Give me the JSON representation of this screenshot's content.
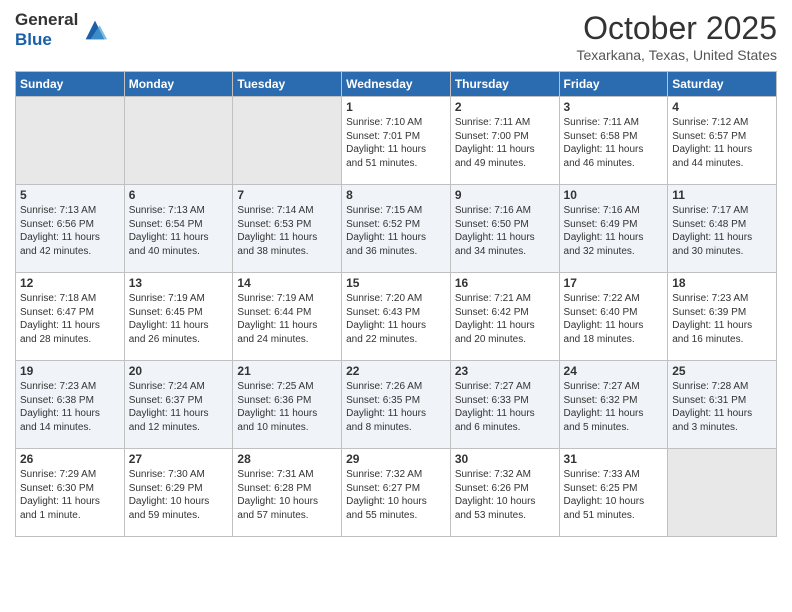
{
  "header": {
    "logo_line1": "General",
    "logo_line2": "Blue",
    "month": "October 2025",
    "location": "Texarkana, Texas, United States"
  },
  "days_of_week": [
    "Sunday",
    "Monday",
    "Tuesday",
    "Wednesday",
    "Thursday",
    "Friday",
    "Saturday"
  ],
  "weeks": [
    [
      {
        "day": "",
        "info": ""
      },
      {
        "day": "",
        "info": ""
      },
      {
        "day": "",
        "info": ""
      },
      {
        "day": "1",
        "info": "Sunrise: 7:10 AM\nSunset: 7:01 PM\nDaylight: 11 hours\nand 51 minutes."
      },
      {
        "day": "2",
        "info": "Sunrise: 7:11 AM\nSunset: 7:00 PM\nDaylight: 11 hours\nand 49 minutes."
      },
      {
        "day": "3",
        "info": "Sunrise: 7:11 AM\nSunset: 6:58 PM\nDaylight: 11 hours\nand 46 minutes."
      },
      {
        "day": "4",
        "info": "Sunrise: 7:12 AM\nSunset: 6:57 PM\nDaylight: 11 hours\nand 44 minutes."
      }
    ],
    [
      {
        "day": "5",
        "info": "Sunrise: 7:13 AM\nSunset: 6:56 PM\nDaylight: 11 hours\nand 42 minutes."
      },
      {
        "day": "6",
        "info": "Sunrise: 7:13 AM\nSunset: 6:54 PM\nDaylight: 11 hours\nand 40 minutes."
      },
      {
        "day": "7",
        "info": "Sunrise: 7:14 AM\nSunset: 6:53 PM\nDaylight: 11 hours\nand 38 minutes."
      },
      {
        "day": "8",
        "info": "Sunrise: 7:15 AM\nSunset: 6:52 PM\nDaylight: 11 hours\nand 36 minutes."
      },
      {
        "day": "9",
        "info": "Sunrise: 7:16 AM\nSunset: 6:50 PM\nDaylight: 11 hours\nand 34 minutes."
      },
      {
        "day": "10",
        "info": "Sunrise: 7:16 AM\nSunset: 6:49 PM\nDaylight: 11 hours\nand 32 minutes."
      },
      {
        "day": "11",
        "info": "Sunrise: 7:17 AM\nSunset: 6:48 PM\nDaylight: 11 hours\nand 30 minutes."
      }
    ],
    [
      {
        "day": "12",
        "info": "Sunrise: 7:18 AM\nSunset: 6:47 PM\nDaylight: 11 hours\nand 28 minutes."
      },
      {
        "day": "13",
        "info": "Sunrise: 7:19 AM\nSunset: 6:45 PM\nDaylight: 11 hours\nand 26 minutes."
      },
      {
        "day": "14",
        "info": "Sunrise: 7:19 AM\nSunset: 6:44 PM\nDaylight: 11 hours\nand 24 minutes."
      },
      {
        "day": "15",
        "info": "Sunrise: 7:20 AM\nSunset: 6:43 PM\nDaylight: 11 hours\nand 22 minutes."
      },
      {
        "day": "16",
        "info": "Sunrise: 7:21 AM\nSunset: 6:42 PM\nDaylight: 11 hours\nand 20 minutes."
      },
      {
        "day": "17",
        "info": "Sunrise: 7:22 AM\nSunset: 6:40 PM\nDaylight: 11 hours\nand 18 minutes."
      },
      {
        "day": "18",
        "info": "Sunrise: 7:23 AM\nSunset: 6:39 PM\nDaylight: 11 hours\nand 16 minutes."
      }
    ],
    [
      {
        "day": "19",
        "info": "Sunrise: 7:23 AM\nSunset: 6:38 PM\nDaylight: 11 hours\nand 14 minutes."
      },
      {
        "day": "20",
        "info": "Sunrise: 7:24 AM\nSunset: 6:37 PM\nDaylight: 11 hours\nand 12 minutes."
      },
      {
        "day": "21",
        "info": "Sunrise: 7:25 AM\nSunset: 6:36 PM\nDaylight: 11 hours\nand 10 minutes."
      },
      {
        "day": "22",
        "info": "Sunrise: 7:26 AM\nSunset: 6:35 PM\nDaylight: 11 hours\nand 8 minutes."
      },
      {
        "day": "23",
        "info": "Sunrise: 7:27 AM\nSunset: 6:33 PM\nDaylight: 11 hours\nand 6 minutes."
      },
      {
        "day": "24",
        "info": "Sunrise: 7:27 AM\nSunset: 6:32 PM\nDaylight: 11 hours\nand 5 minutes."
      },
      {
        "day": "25",
        "info": "Sunrise: 7:28 AM\nSunset: 6:31 PM\nDaylight: 11 hours\nand 3 minutes."
      }
    ],
    [
      {
        "day": "26",
        "info": "Sunrise: 7:29 AM\nSunset: 6:30 PM\nDaylight: 11 hours\nand 1 minute."
      },
      {
        "day": "27",
        "info": "Sunrise: 7:30 AM\nSunset: 6:29 PM\nDaylight: 10 hours\nand 59 minutes."
      },
      {
        "day": "28",
        "info": "Sunrise: 7:31 AM\nSunset: 6:28 PM\nDaylight: 10 hours\nand 57 minutes."
      },
      {
        "day": "29",
        "info": "Sunrise: 7:32 AM\nSunset: 6:27 PM\nDaylight: 10 hours\nand 55 minutes."
      },
      {
        "day": "30",
        "info": "Sunrise: 7:32 AM\nSunset: 6:26 PM\nDaylight: 10 hours\nand 53 minutes."
      },
      {
        "day": "31",
        "info": "Sunrise: 7:33 AM\nSunset: 6:25 PM\nDaylight: 10 hours\nand 51 minutes."
      },
      {
        "day": "",
        "info": ""
      }
    ]
  ]
}
